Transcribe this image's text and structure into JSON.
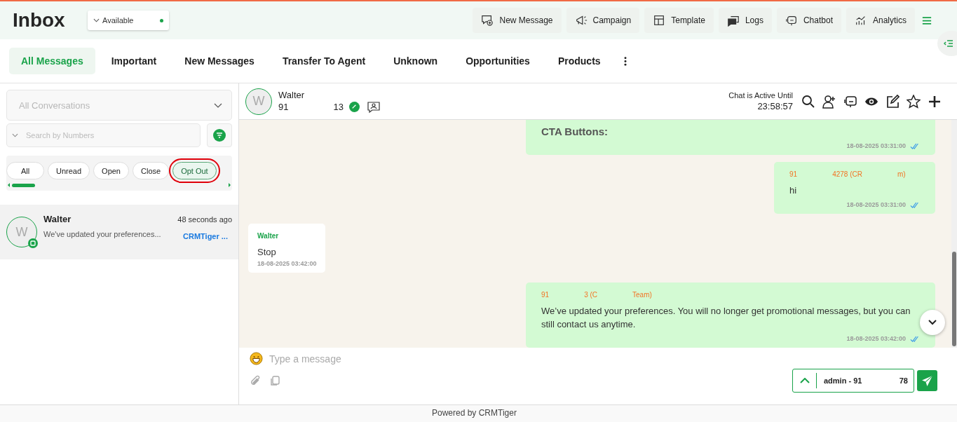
{
  "header": {
    "title": "Inbox",
    "status": {
      "label": "Available",
      "color": "#1aa34a"
    },
    "actions": [
      {
        "label": "New Message",
        "kind": "new-message"
      },
      {
        "label": "Campaign",
        "kind": "campaign"
      },
      {
        "label": "Template",
        "kind": "template"
      },
      {
        "label": "Logs",
        "kind": "logs"
      },
      {
        "label": "Chatbot",
        "kind": "chatbot"
      },
      {
        "label": "Analytics",
        "kind": "analytics"
      }
    ]
  },
  "tabs": [
    {
      "label": "All Messages",
      "selected": true
    },
    {
      "label": "Important",
      "selected": false
    },
    {
      "label": "New Messages",
      "selected": false
    },
    {
      "label": "Transfer To Agent",
      "selected": false
    },
    {
      "label": "Unknown",
      "selected": false
    },
    {
      "label": "Opportunities",
      "selected": false
    },
    {
      "label": "Products",
      "selected": false
    }
  ],
  "sidebar": {
    "conversation_filter": {
      "placeholder": "All Conversations"
    },
    "search": {
      "placeholder": "Search by Numbers"
    },
    "chips": [
      {
        "label": "All",
        "selected": false,
        "highlighted": false
      },
      {
        "label": "Unread",
        "selected": false,
        "highlighted": false
      },
      {
        "label": "Open",
        "selected": false,
        "highlighted": false
      },
      {
        "label": "Close",
        "selected": false,
        "highlighted": false
      },
      {
        "label": "Opt Out",
        "selected": true,
        "highlighted": true
      }
    ],
    "conversations": [
      {
        "initial": "W",
        "name": "Walter",
        "time": "48 seconds ago",
        "preview": "We've updated your preferences...",
        "agent": "CRMTiger ...",
        "selected": true
      }
    ]
  },
  "chat": {
    "contact": {
      "initial": "W",
      "name": "Walter",
      "phone_parts": [
        "91",
        "13"
      ]
    },
    "active_label": "Chat is Active Until",
    "active_time": "23:58:57",
    "messages": [
      {
        "kind": "outgoing",
        "text": "CTA Buttons:",
        "time": "18-08-2025 03:31:00",
        "read": true
      },
      {
        "kind": "outgoing",
        "sender_parts": [
          "91",
          "4278 (CR",
          "m)"
        ],
        "text": "hi",
        "time": "18-08-2025 03:31:00",
        "read": true
      },
      {
        "kind": "incoming",
        "sender_parts": [
          "Walter"
        ],
        "text": "Stop",
        "time": "18-08-2025 03:42:00"
      },
      {
        "kind": "outgoing",
        "sender_parts": [
          "91",
          "3 (C",
          "Team)"
        ],
        "text": "We’ve updated your preferences. You will no longer get promotional messages, but you can still contact us anytime.",
        "time": "18-08-2025 03:42:00",
        "read": true
      }
    ],
    "composer": {
      "placeholder": "Type a message"
    },
    "agent": {
      "parts": [
        "admin - 91",
        "78"
      ]
    }
  },
  "footer": "Powered by CRMTiger"
}
